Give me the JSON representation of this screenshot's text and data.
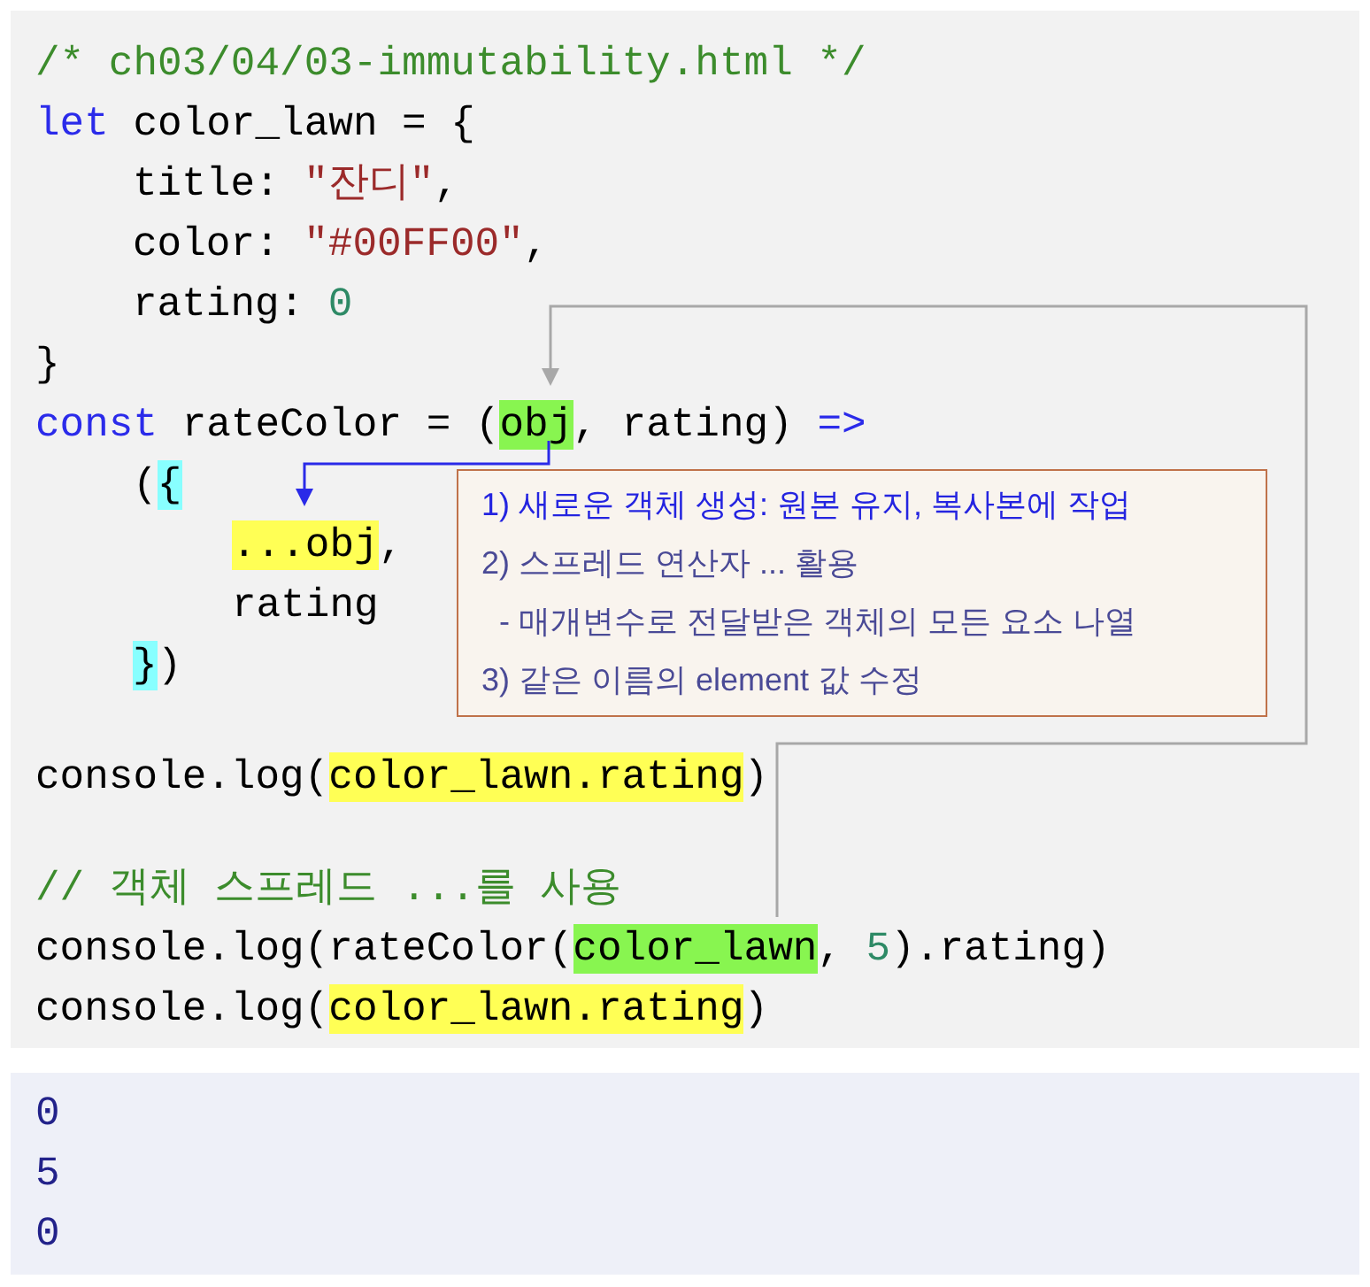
{
  "code": {
    "groups": [
      {
        "lines": [
          {
            "tokens": [
              {
                "text": "/* ch03/04/03-immutability.html */",
                "kind": "comment"
              }
            ]
          },
          {
            "tokens": [
              {
                "text": "let",
                "kind": "keyword"
              },
              {
                "text": " color_lawn = {",
                "kind": "plain"
              }
            ],
            "children": [
              {
                "tokens": [
                  {
                    "text": "title: ",
                    "kind": "plain"
                  },
                  {
                    "text": "\"잔디\"",
                    "kind": "string"
                  },
                  {
                    "text": ",",
                    "kind": "plain"
                  }
                ]
              },
              {
                "tokens": [
                  {
                    "text": "color: ",
                    "kind": "plain"
                  },
                  {
                    "text": "\"#00FF00\"",
                    "kind": "string"
                  },
                  {
                    "text": ",",
                    "kind": "plain"
                  }
                ]
              },
              {
                "tokens": [
                  {
                    "text": "rating: ",
                    "kind": "plain"
                  },
                  {
                    "text": "0",
                    "kind": "number"
                  }
                ]
              }
            ]
          },
          {
            "tokens": [
              {
                "text": "}",
                "kind": "plain"
              }
            ]
          },
          {
            "tokens": [
              {
                "text": "const",
                "kind": "keyword"
              },
              {
                "text": " rateColor = (",
                "kind": "plain"
              },
              {
                "text": "obj",
                "kind": "plain",
                "color": "#88f550"
              },
              {
                "text": ", rating) ",
                "kind": "plain"
              },
              {
                "text": "=>",
                "kind": "keyword"
              }
            ],
            "children": [
              {
                "tokens": [
                  {
                    "text": "(",
                    "kind": "plain"
                  },
                  {
                    "text": "{",
                    "kind": "plain",
                    "color": "#88ffff"
                  }
                ],
                "children": [
                  {
                    "tokens": [
                      {
                        "text": "...obj",
                        "kind": "plain",
                        "color": "#ffff55"
                      },
                      {
                        "text": ",",
                        "kind": "plain"
                      }
                    ]
                  },
                  {
                    "tokens": [
                      {
                        "text": "rating",
                        "kind": "plain"
                      }
                    ]
                  }
                ]
              },
              {
                "tokens": [
                  {
                    "text": "}",
                    "kind": "plain",
                    "color": "#88ffff"
                  },
                  {
                    "text": ")",
                    "kind": "plain"
                  }
                ]
              }
            ]
          }
        ]
      },
      {
        "lines": [
          {
            "tokens": [
              {
                "text": "console.log(",
                "kind": "plain"
              },
              {
                "text": "color_lawn.rating",
                "kind": "plain",
                "color": "#ffff55"
              },
              {
                "text": ")",
                "kind": "plain"
              }
            ]
          }
        ]
      },
      {
        "lines": [
          {
            "tokens": [
              {
                "text": "// 객체 스프레드 ...를 사용",
                "kind": "comment"
              }
            ]
          },
          {
            "tokens": [
              {
                "text": "console.log(rateColor(",
                "kind": "plain"
              },
              {
                "text": "color_lawn",
                "kind": "plain",
                "color": "#88f550"
              },
              {
                "text": ", ",
                "kind": "plain"
              },
              {
                "text": "5",
                "kind": "number"
              },
              {
                "text": ").rating)",
                "kind": "plain"
              }
            ]
          },
          {
            "tokens": [
              {
                "text": "console.log(",
                "kind": "plain"
              },
              {
                "text": "color_lawn.rating",
                "kind": "plain",
                "color": "#ffff55"
              },
              {
                "text": ")",
                "kind": "plain"
              }
            ]
          }
        ]
      }
    ]
  },
  "note": [
    {
      "text": "1) 새로운 객체 생성: 원본 유지, 복사본에 작업",
      "emphasis": true
    },
    {
      "text": "2) 스프레드 연산자 ... 활용",
      "emphasis": false
    },
    {
      "text": "  - 매개변수로 전달받은 객체의 모든 요소 나열",
      "emphasis": false
    },
    {
      "text": "3) 같은 이름의 element 값 수정",
      "emphasis": false
    }
  ],
  "output": [
    "0",
    "5",
    "0"
  ]
}
